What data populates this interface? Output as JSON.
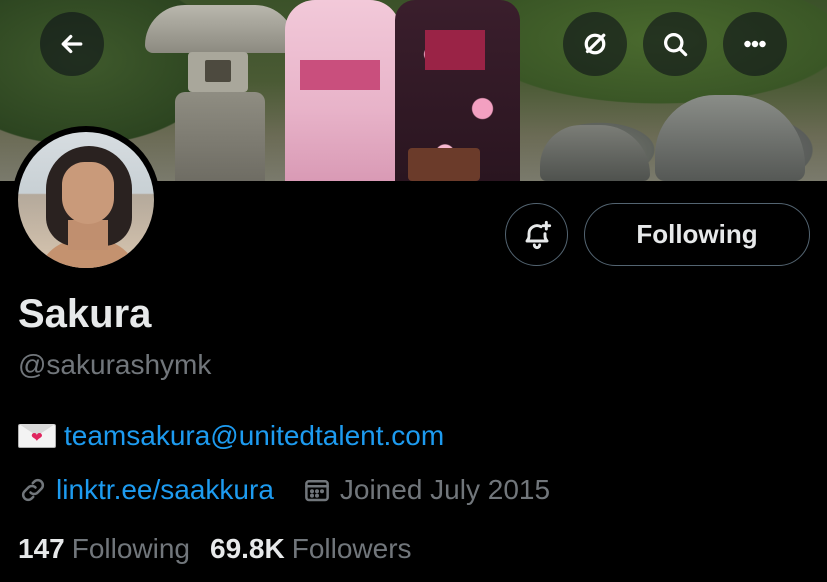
{
  "header": {
    "back_icon": "arrow-left-icon",
    "grok_icon": "grok-icon",
    "search_icon": "search-icon",
    "more_icon": "more-horizontal-icon"
  },
  "profile": {
    "display_name": "Sakura",
    "handle": "@sakurashymk",
    "bio_emoji": "love-letter-icon",
    "bio_link": "teamsakura@unitedtalent.com",
    "website": "linktr.ee/saakkura",
    "joined": "Joined July 2015"
  },
  "actions": {
    "notify_icon": "bell-plus-icon",
    "following_label": "Following"
  },
  "stats": {
    "following_count": "147",
    "following_label": "Following",
    "followers_count": "69.8K",
    "followers_label": "Followers"
  },
  "colors": {
    "background": "#000000",
    "primary_text": "#e7e9ea",
    "secondary_text": "#71767b",
    "link": "#1d9bf0",
    "border": "#536471"
  }
}
